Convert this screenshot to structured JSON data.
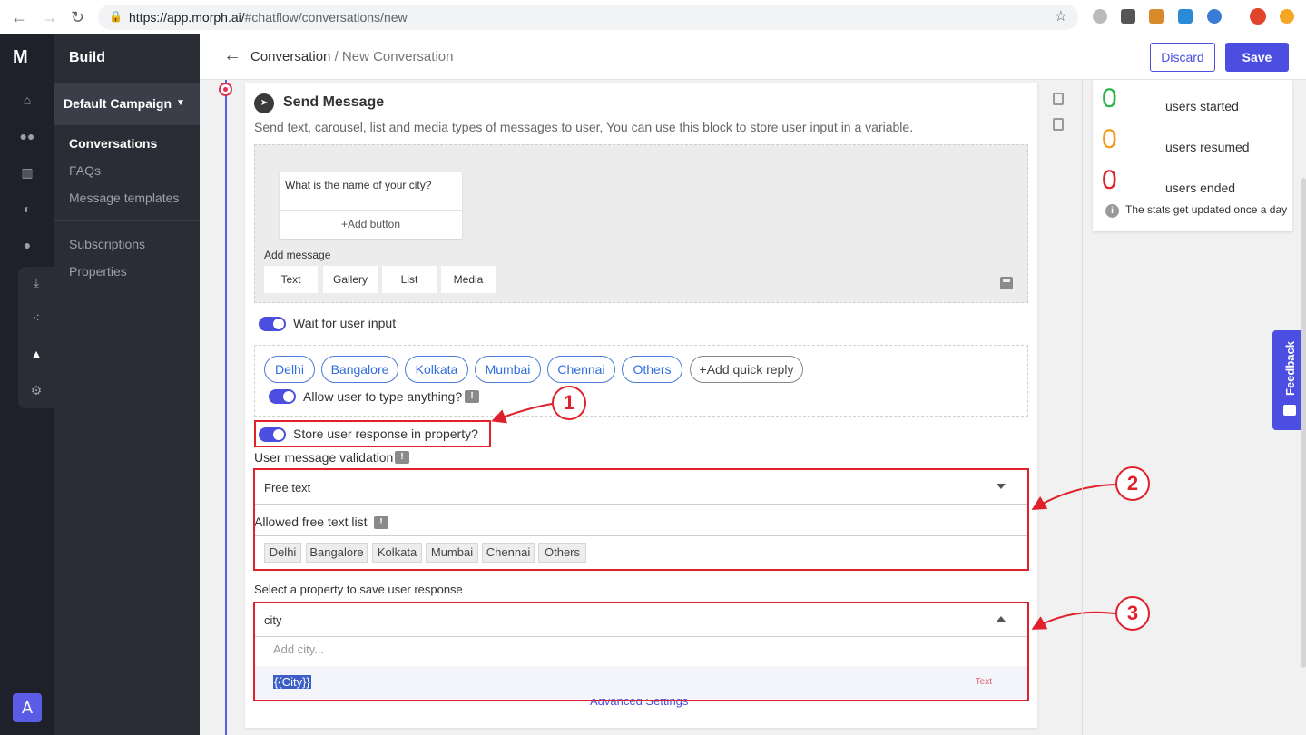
{
  "browser": {
    "url_host": "https://app.morph.ai/",
    "url_path": "#chatflow/conversations/new"
  },
  "sidebar": {
    "title": "Build",
    "campaign": "Default Campaign",
    "items": [
      {
        "label": "Conversations"
      },
      {
        "label": "FAQs"
      },
      {
        "label": "Message templates"
      },
      {
        "label": "Subscriptions"
      },
      {
        "label": "Properties"
      }
    ],
    "avatar": "A"
  },
  "header": {
    "breadcrumb_root": "Conversation",
    "breadcrumb_sep": "/",
    "breadcrumb_current": "New Conversation",
    "discard_label": "Discard",
    "save_label": "Save"
  },
  "block": {
    "title": "Send Message",
    "description": "Send text, carousel, list and media types of messages to user, You can use this block to store user input in a variable.",
    "bubble_text": "What is the name of your city?",
    "bubble_add_button": "+Add button",
    "add_message_label": "Add message",
    "message_types": [
      "Text",
      "Gallery",
      "List",
      "Media"
    ],
    "wait_for_input_label": "Wait for user input",
    "quick_replies": [
      "Delhi",
      "Bangalore",
      "Kolkata",
      "Mumbai",
      "Chennai",
      "Others"
    ],
    "add_quick_reply": "+Add quick reply",
    "allow_typing_label": "Allow user to type anything?",
    "store_response_label": "Store user response in property?",
    "validation_label": "User message validation",
    "validation_value": "Free text",
    "allowed_list_label": "Allowed free text list",
    "allowed_list": [
      "Delhi",
      "Bangalore",
      "Kolkata",
      "Mumbai",
      "Chennai",
      "Others"
    ],
    "property_label": "Select a property to save user response",
    "property_value": "city",
    "property_add_placeholder": "Add city...",
    "property_option_name": "{{City}}",
    "property_option_type": "Text",
    "advanced_settings": "Advanced Settings"
  },
  "annotations": [
    "1",
    "2",
    "3"
  ],
  "stats": {
    "started_count": "0",
    "started_label": "users started",
    "resumed_count": "0",
    "resumed_label": "users resumed",
    "ended_count": "0",
    "ended_label": "users ended",
    "note": "The stats get updated once a day",
    "colors": {
      "started": "#2db34a",
      "resumed": "#f39a1e",
      "ended": "#e0202a"
    }
  },
  "feedback_label": "Feedback",
  "accent_color": "#4b4ee0"
}
